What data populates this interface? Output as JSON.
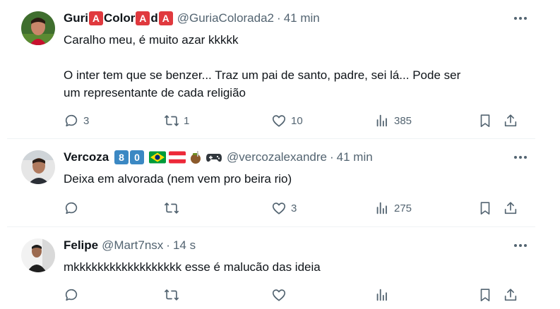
{
  "tweets": [
    {
      "name_parts": [
        "Guri",
        "A",
        "Color",
        "A",
        "d",
        "A"
      ],
      "handle": "@GuriaColorada2",
      "time": "41 min",
      "text_line1": "Caralho meu, é muito azar kkkkk",
      "text_line2": "O inter tem que se benzer... Traz um pai de santo, padre, sei lá... Pode ser",
      "text_line3": "um representante de cada religião",
      "replies": "3",
      "retweets": "1",
      "likes": "10",
      "views": "385"
    },
    {
      "name": "Vercoza",
      "badges": [
        "8",
        "0"
      ],
      "handle": "@vercozalexandre",
      "time": "41 min",
      "text_line1": "Deixa em alvorada (nem vem pro beira rio)",
      "replies": "",
      "retweets": "",
      "likes": "3",
      "views": "275"
    },
    {
      "name": "Felipe",
      "handle": "@Mart7nsx",
      "time": "14 s",
      "text_line1": "mkkkkkkkkkkkkkkkkkk esse é malucão das ideia",
      "replies": "",
      "retweets": "",
      "likes": "",
      "views": ""
    }
  ],
  "separator": "·",
  "icons": {
    "more": "more-horizontal-icon",
    "reply": "reply-icon",
    "retweet": "retweet-icon",
    "like": "heart-icon",
    "views": "views-icon",
    "bookmark": "bookmark-icon",
    "share": "share-icon"
  },
  "colors": {
    "text_primary": "#0f1419",
    "text_secondary": "#536471",
    "divider": "#eff3f4",
    "emoji_red": "#e0393e",
    "emoji_blue": "#3b88c3"
  }
}
